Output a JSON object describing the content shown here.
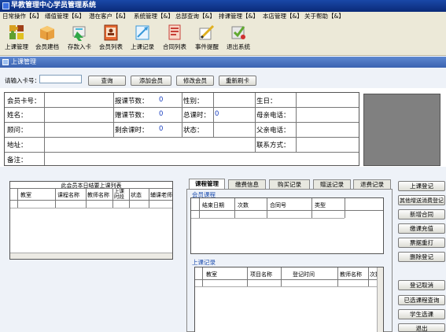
{
  "window": {
    "title": "早教管理中心学员管理系统"
  },
  "menu": [
    "日常操作【&】",
    "缮值管理【&】",
    "潜在客户【&】",
    "系统管理【&】",
    "总部查询【&】",
    "排课管理【&】",
    "本店管理【&】",
    "关于帮助【&】"
  ],
  "toolbar": [
    {
      "label": "上课管理",
      "icon": "puzzle-icon",
      "color": "#d8a020"
    },
    {
      "label": "会员建档",
      "icon": "box-icon",
      "color": "#e07818"
    },
    {
      "label": "存款入卡",
      "icon": "arrow-icon",
      "color": "#48b8d8"
    },
    {
      "label": "会员列表",
      "icon": "list-icon",
      "color": "#c85028"
    },
    {
      "label": "上课记录",
      "icon": "chart-icon",
      "color": "#3898d8"
    },
    {
      "label": "合同列表",
      "icon": "contract-icon",
      "color": "#c84038"
    },
    {
      "label": "事件提醒",
      "icon": "pencil-icon",
      "color": "#e0b020"
    },
    {
      "label": "退出系统",
      "icon": "exit-icon",
      "color": "#60a830"
    }
  ],
  "panel": {
    "title": "上课管理"
  },
  "search": {
    "label": "请输入卡号：",
    "value": "",
    "buttons": {
      "query": "查询",
      "add": "添加会员",
      "edit": "修改会员",
      "rebind": "重新刷卡"
    }
  },
  "info": {
    "card_label": "会员卡号：",
    "name_label": "姓名：",
    "advisor_label": "顾问：",
    "address_label": "地址：",
    "note_label": "备注：",
    "report_label": "报课节数：",
    "report_value": "0",
    "gift_label": "赠课节数：",
    "gift_value": "0",
    "remain_label": "剩余课时：",
    "remain_value": "0",
    "gender_label": "性别：",
    "total_label": "总课时：",
    "total_value": "0",
    "status_label": "状态：",
    "birthday_label": "生日：",
    "mother_label": "母亲电话：",
    "father_label": "父亲电话：",
    "contact_label": "联系方式："
  },
  "today": {
    "title": "此会员本日结要上课列表",
    "columns": [
      "教室",
      "课程名称",
      "教师名称",
      "上课时段",
      "状态",
      "辅课老师"
    ]
  },
  "tabs": [
    "课程管理",
    "缴费信息",
    "购买记录",
    "赠送记录",
    "退费记录"
  ],
  "member_courses": {
    "title": "会员课程",
    "columns": [
      "结束日期",
      "次数",
      "合同号",
      "类型"
    ]
  },
  "class_records": {
    "title": "上课记录",
    "columns": [
      "教室",
      "项目名称",
      "登记时间",
      "教师名称",
      "次数"
    ]
  },
  "side_buttons": [
    "上课登记",
    "其他增送消费登记",
    "新增合同",
    "缴课充值",
    "票据重打",
    "删除登记",
    "登记取消",
    "已选课程查询",
    "学生选课",
    "退出"
  ]
}
